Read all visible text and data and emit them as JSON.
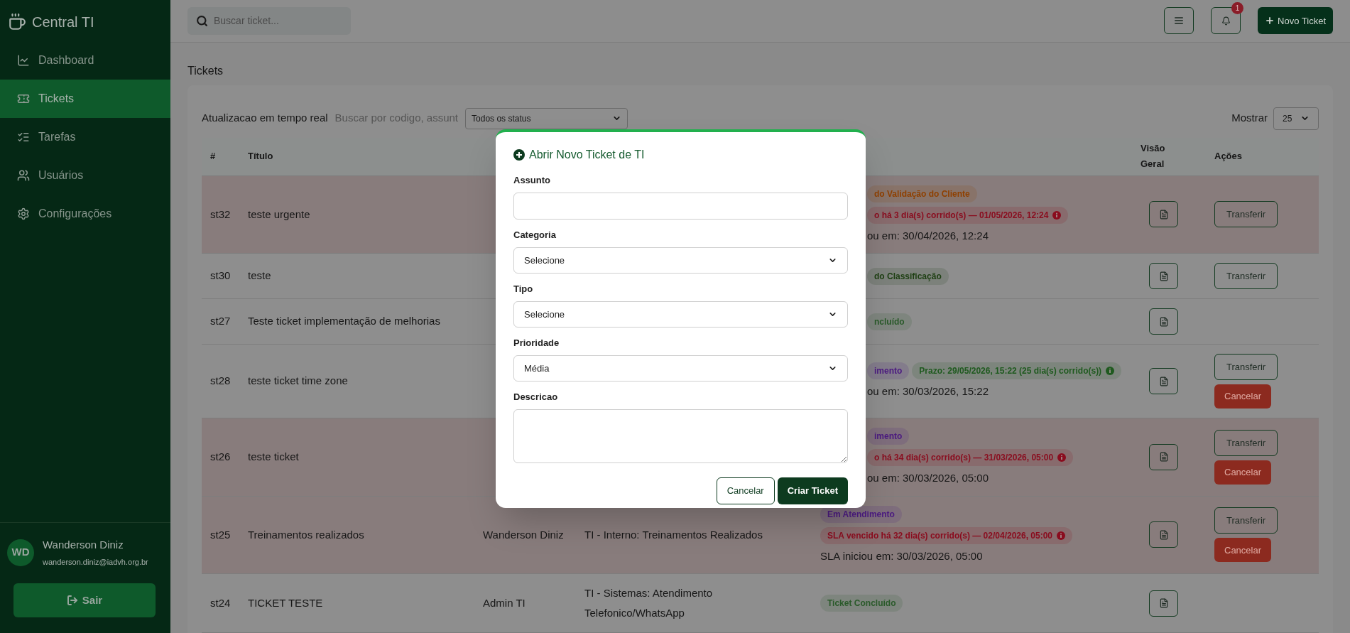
{
  "sidebar": {
    "brand": "Central TI",
    "items": [
      {
        "label": "Dashboard",
        "selected": false
      },
      {
        "label": "Tickets",
        "selected": true
      },
      {
        "label": "Tarefas",
        "selected": false
      },
      {
        "label": "Usuários",
        "selected": false
      },
      {
        "label": "Configurações",
        "selected": false
      }
    ],
    "user": {
      "initials": "WD",
      "name": "Wanderson Diniz",
      "email": "wanderson.diniz@iadvh.org.br"
    },
    "logout": "Sair"
  },
  "topbar": {
    "search_placeholder": "Buscar ticket...",
    "notifications": "1",
    "new_ticket": "Novo Ticket"
  },
  "page_title": "Tickets",
  "filters": {
    "live": "Atualizacao em tempo real",
    "search_placeholder": "Buscar por codigo, assunt",
    "status": "Todos os status",
    "show_label": "Mostrar",
    "show": "25"
  },
  "table": {
    "columns": {
      "number": "#",
      "title": "Título",
      "overview": "Visão Geral",
      "actions": "Ações"
    },
    "rows": [
      {
        "kind": "covered",
        "id": "st32",
        "title": "teste urgente",
        "overdue": true,
        "status": [
          [
            {
              "kind": "badge",
              "text": "do Validação do Cliente",
              "color": "#8f4000",
              "info": false
            }
          ],
          [
            {
              "kind": "badge",
              "text": "o há 3 dia(s) corrido(s) — 01/05/2026, 12:24",
              "color": "#8a0c1e",
              "info": true
            }
          ],
          [
            {
              "kind": "text",
              "text": "ou em: 30/04/2026, 12:24"
            }
          ]
        ],
        "transfer": "Transferir"
      },
      {
        "kind": "covered",
        "id": "st30",
        "title": "teste",
        "overdue": false,
        "status": [
          [
            {
              "kind": "badge",
              "text": "do Classificação",
              "color": "#1d3f12",
              "info": false
            }
          ]
        ],
        "transfer": "Transferir"
      },
      {
        "kind": "covered",
        "id": "st27",
        "title": "Teste ticket implementação de melhorias",
        "overdue": false,
        "status": [
          [
            {
              "kind": "badge",
              "text": "ncluído",
              "color": "#2a5a2a",
              "info": false
            }
          ]
        ]
      },
      {
        "kind": "covered",
        "id": "st28",
        "title": "teste ticket time zone",
        "overdue": false,
        "status": [
          [
            {
              "kind": "badge",
              "text": "imento",
              "color": "#4b1a80",
              "info": false
            },
            {
              "kind": "badge",
              "text": "Prazo: 29/05/2026, 15:22 (25 dia(s) corrido(s))",
              "color": "#1f5a1f",
              "info": true
            }
          ],
          [
            {
              "kind": "text",
              "text": "ou em: 30/03/2026, 15:22"
            }
          ]
        ],
        "transfer": "Transferir",
        "cancel": "Cancelar"
      },
      {
        "kind": "covered",
        "id": "st26",
        "title": "teste ticket",
        "overdue": true,
        "status": [
          [
            {
              "kind": "badge",
              "text": "imento",
              "color": "#4b1a80",
              "info": false
            }
          ],
          [
            {
              "kind": "badge",
              "text": "o há 34 dia(s) corrido(s) — 31/03/2026, 05:00",
              "color": "#8a0c1e",
              "info": true
            }
          ],
          [
            {
              "kind": "text",
              "text": "ou em: 30/03/2026, 05:00"
            }
          ]
        ],
        "transfer": "Transferir",
        "cancel": "Cancelar"
      },
      {
        "kind": "full",
        "id": "st25",
        "title": "Treinamentos realizados",
        "overdue": true,
        "requester": "Wanderson Diniz",
        "category": "TI - Interno: Treinamentos Realizados",
        "status": [
          [
            {
              "kind": "badge",
              "text": "Em Atendimento",
              "color": "#4b1a80",
              "info": false
            }
          ],
          [
            {
              "kind": "badge",
              "text": "SLA vencido há 32 dia(s) corrido(s) — 02/04/2026, 05:00",
              "color": "#8a0c1e",
              "info": true
            }
          ],
          [
            {
              "kind": "text",
              "text": "SLA iniciou em: 30/03/2026, 05:00"
            }
          ]
        ],
        "transfer": "Transferir",
        "cancel": "Cancelar"
      },
      {
        "kind": "full",
        "id": "st24",
        "title": "TICKET TESTE",
        "overdue": false,
        "requester": "Admin TI",
        "category": "TI - Sistemas: Atendimento Telefonico/WhatsApp",
        "status": [
          [
            {
              "kind": "badge",
              "text": "Ticket Concluído",
              "color": "#2a5a2a",
              "info": false
            }
          ]
        ]
      }
    ]
  },
  "modal": {
    "title": "Abrir Novo Ticket de TI",
    "fields": [
      {
        "kind": "text",
        "label": "Assunto"
      },
      {
        "kind": "select",
        "label": "Categoria",
        "value": "Selecione"
      },
      {
        "kind": "select",
        "label": "Tipo",
        "value": "Selecione"
      },
      {
        "kind": "select",
        "label": "Prioridade",
        "value": "Média"
      },
      {
        "kind": "textarea",
        "label": "Descricao"
      }
    ],
    "cancel": "Cancelar",
    "submit": "Criar Ticket"
  }
}
